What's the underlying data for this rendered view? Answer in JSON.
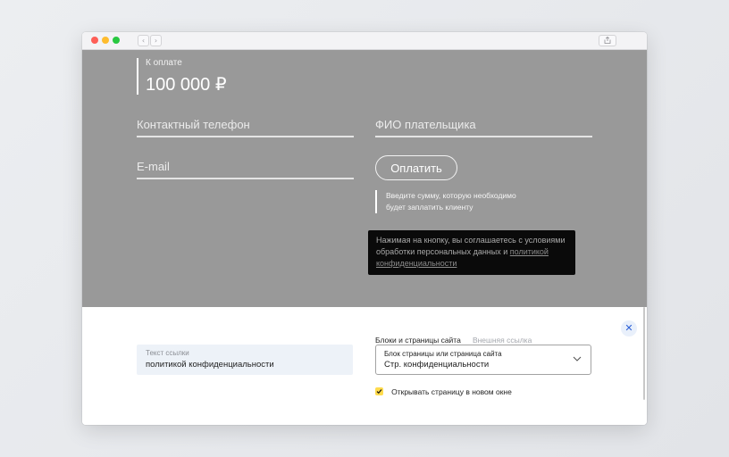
{
  "browser": {
    "back_icon": "chevron-left-icon",
    "forward_icon": "chevron-right-icon",
    "share_icon": "share-icon",
    "tabs_icon": "tabs-icon",
    "back_glyph": "‹",
    "forward_glyph": "›"
  },
  "form": {
    "amount_label": "К оплате",
    "amount_value": "100 000 ₽",
    "phone_placeholder": "Контактный телефон",
    "fio_placeholder": "ФИО плательщика",
    "email_placeholder": "E-mail",
    "pay_button": "Оплатить",
    "hint_line1": "Введите сумму, которую необходимо",
    "hint_line2": "будет заплатить клиенту",
    "overlay_color": "#999999"
  },
  "tooltip": {
    "text_before": "Нажимая на кнопку, вы соглашаетесь с условиями обработки персональных данных и ",
    "link_text": "политикой конфиденциальности"
  },
  "link_panel": {
    "close_icon": "close-icon",
    "close_glyph": "✕",
    "link_text_label": "Текст ссылки",
    "link_text_value": "политикой конфиденциальности",
    "tab_active": "Блоки и страницы сайта",
    "tab_inactive": "Внешняя ссылка",
    "select_label": "Блок страницы или страница сайта",
    "select_value": "Стр. конфиденциальности",
    "new_window_label": "Открывать страницу в новом окне",
    "new_window_checked": true,
    "accent_color": "#ffdb4d"
  }
}
